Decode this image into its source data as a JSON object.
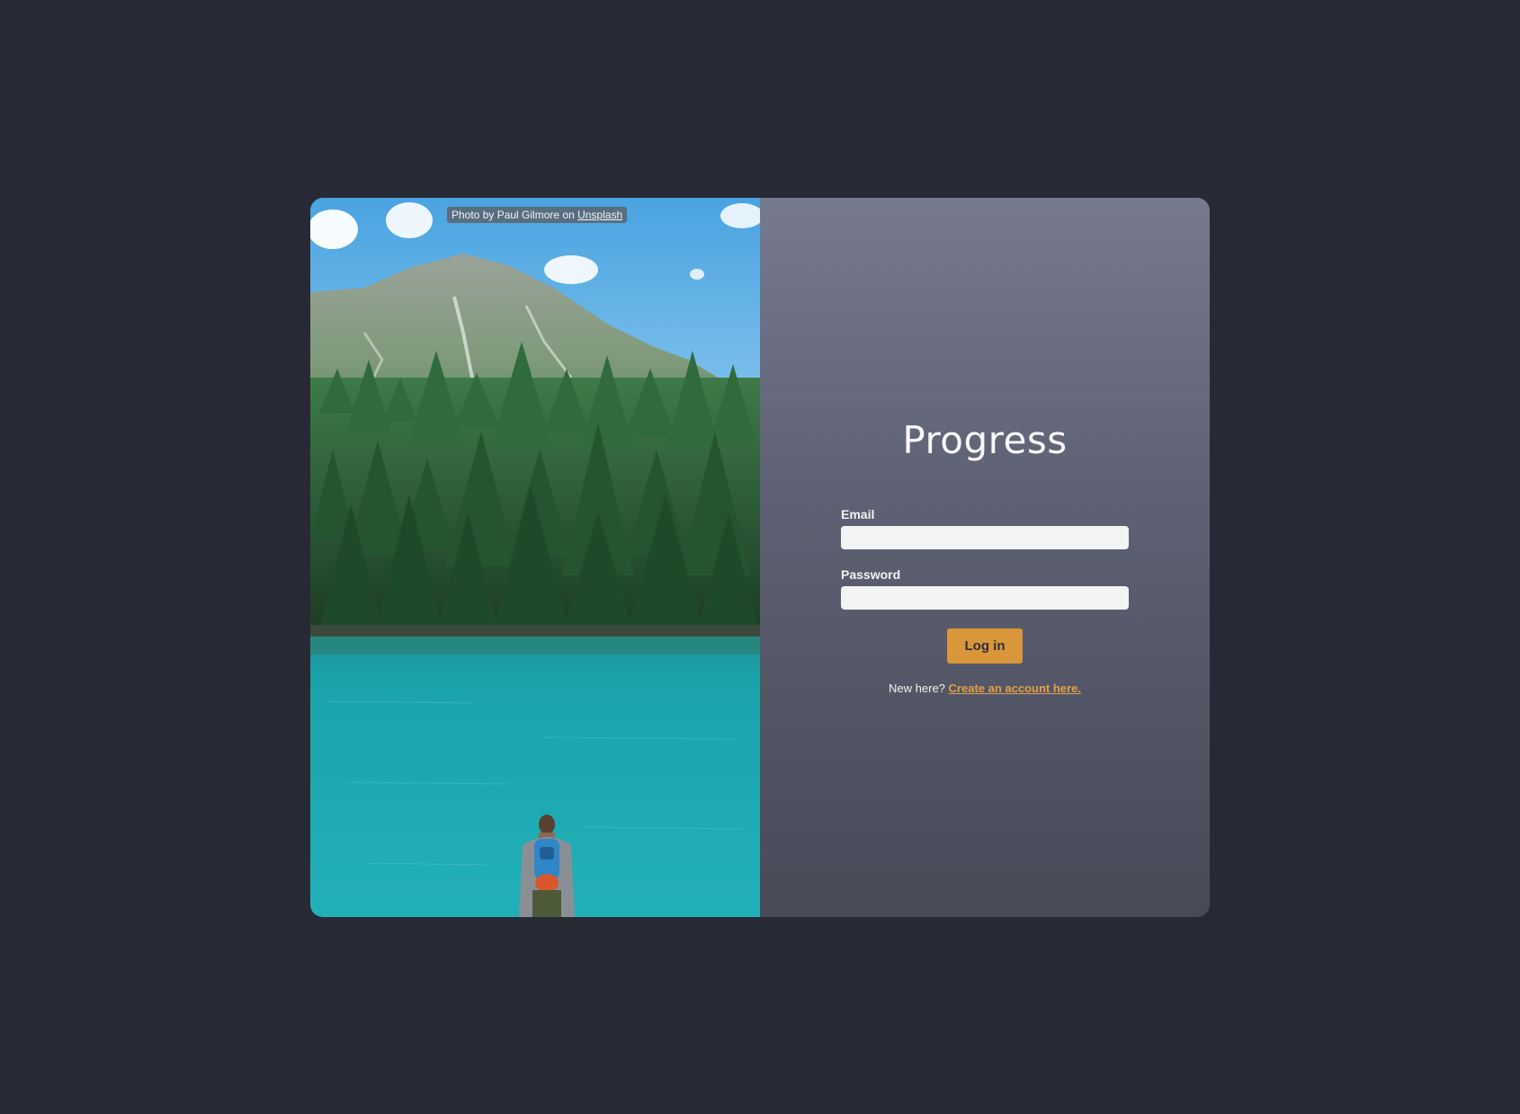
{
  "photo": {
    "credit_prefix": "Photo by Paul Gilmore on",
    "credit_link": "Unsplash",
    "alt": "Hiker with backpack standing at a turquoise mountain lake below a pine forest and rocky peak"
  },
  "app": {
    "title": "Progress"
  },
  "form": {
    "email_label": "Email",
    "email_value": "",
    "password_label": "Password",
    "password_value": "",
    "submit_label": "Log in"
  },
  "signup": {
    "prompt": "New here?",
    "link_text": "Create an account here."
  },
  "colors": {
    "page_background": "#272935",
    "accent": "#d9963a",
    "link": "#e0a048",
    "input_background": "#f2f3f3"
  }
}
